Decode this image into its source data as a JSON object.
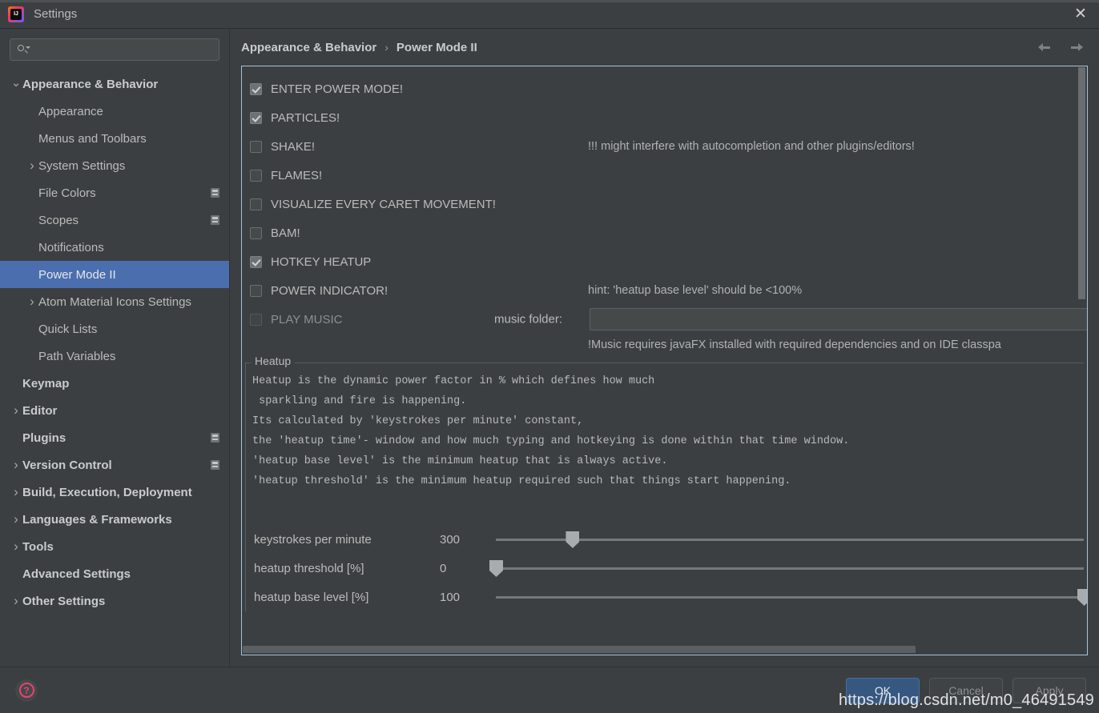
{
  "window": {
    "title": "Settings",
    "app_icon": "intellij-idea-logo",
    "close_label": "✕"
  },
  "sidebar": {
    "search": {
      "value": "",
      "placeholder": ""
    },
    "items": [
      {
        "label": "Appearance & Behavior",
        "indent": 0,
        "chevron": "down",
        "bold": true,
        "selected": false,
        "config_icon": false
      },
      {
        "label": "Appearance",
        "indent": 1,
        "chevron": "",
        "bold": false,
        "selected": false,
        "config_icon": false
      },
      {
        "label": "Menus and Toolbars",
        "indent": 1,
        "chevron": "",
        "bold": false,
        "selected": false,
        "config_icon": false
      },
      {
        "label": "System Settings",
        "indent": 1,
        "chevron": "right",
        "bold": false,
        "selected": false,
        "config_icon": false
      },
      {
        "label": "File Colors",
        "indent": 1,
        "chevron": "",
        "bold": false,
        "selected": false,
        "config_icon": true
      },
      {
        "label": "Scopes",
        "indent": 1,
        "chevron": "",
        "bold": false,
        "selected": false,
        "config_icon": true
      },
      {
        "label": "Notifications",
        "indent": 1,
        "chevron": "",
        "bold": false,
        "selected": false,
        "config_icon": false
      },
      {
        "label": "Power Mode II",
        "indent": 1,
        "chevron": "",
        "bold": false,
        "selected": true,
        "config_icon": false
      },
      {
        "label": "Atom Material Icons Settings",
        "indent": 1,
        "chevron": "right",
        "bold": false,
        "selected": false,
        "config_icon": false
      },
      {
        "label": "Quick Lists",
        "indent": 1,
        "chevron": "",
        "bold": false,
        "selected": false,
        "config_icon": false
      },
      {
        "label": "Path Variables",
        "indent": 1,
        "chevron": "",
        "bold": false,
        "selected": false,
        "config_icon": false
      },
      {
        "label": "Keymap",
        "indent": 0,
        "chevron": "",
        "bold": true,
        "selected": false,
        "config_icon": false
      },
      {
        "label": "Editor",
        "indent": 0,
        "chevron": "right",
        "bold": true,
        "selected": false,
        "config_icon": false
      },
      {
        "label": "Plugins",
        "indent": 0,
        "chevron": "",
        "bold": true,
        "selected": false,
        "config_icon": true
      },
      {
        "label": "Version Control",
        "indent": 0,
        "chevron": "right",
        "bold": true,
        "selected": false,
        "config_icon": true
      },
      {
        "label": "Build, Execution, Deployment",
        "indent": 0,
        "chevron": "right",
        "bold": true,
        "selected": false,
        "config_icon": false
      },
      {
        "label": "Languages & Frameworks",
        "indent": 0,
        "chevron": "right",
        "bold": true,
        "selected": false,
        "config_icon": false
      },
      {
        "label": "Tools",
        "indent": 0,
        "chevron": "right",
        "bold": true,
        "selected": false,
        "config_icon": false
      },
      {
        "label": "Advanced Settings",
        "indent": 0,
        "chevron": "",
        "bold": true,
        "selected": false,
        "config_icon": false
      },
      {
        "label": "Other Settings",
        "indent": 0,
        "chevron": "right",
        "bold": true,
        "selected": false,
        "config_icon": false
      }
    ]
  },
  "breadcrumb": {
    "parent": "Appearance & Behavior",
    "separator": "›",
    "current": "Power Mode II",
    "back_icon": "arrow-left-icon",
    "forward_icon": "arrow-right-icon"
  },
  "options": [
    {
      "label": "ENTER POWER MODE!",
      "checked": true,
      "enabled": true,
      "hint": ""
    },
    {
      "label": "PARTICLES!",
      "checked": true,
      "enabled": true,
      "hint": ""
    },
    {
      "label": "SHAKE!",
      "checked": false,
      "enabled": true,
      "hint": "!!! might interfere with autocompletion and other plugins/editors!"
    },
    {
      "label": "FLAMES!",
      "checked": false,
      "enabled": true,
      "hint": ""
    },
    {
      "label": "VISUALIZE EVERY CARET MOVEMENT!",
      "checked": false,
      "enabled": true,
      "hint": ""
    },
    {
      "label": "BAM!",
      "checked": false,
      "enabled": true,
      "hint": ""
    },
    {
      "label": "HOTKEY HEATUP",
      "checked": true,
      "enabled": true,
      "hint": ""
    },
    {
      "label": "POWER INDICATOR!",
      "checked": false,
      "enabled": true,
      "hint": "hint: 'heatup base level' should be <100%"
    }
  ],
  "music": {
    "checkbox_label": "PLAY MUSIC",
    "checked": false,
    "enabled": false,
    "folder_label": "music folder:",
    "folder_value": "",
    "note": "!Music requires javaFX installed with required dependencies and on IDE classpa"
  },
  "heatup": {
    "legend": "Heatup",
    "description_lines": [
      "Heatup is the dynamic power factor in % which defines how much",
      " sparkling and fire is happening.",
      "Its calculated by 'keystrokes per minute' constant,",
      "the 'heatup time'- window and how much typing and hotkeying is done within that time window.",
      "'heatup base level' is the minimum heatup that is always active.",
      "'heatup threshold' is the minimum heatup required such that things start happening."
    ],
    "sliders": [
      {
        "name": "keystrokes per minute",
        "value": "300",
        "percent": 13
      },
      {
        "name": "heatup threshold [%]",
        "value": "0",
        "percent": 0
      },
      {
        "name": "heatup base level [%]",
        "value": "100",
        "percent": 100
      }
    ]
  },
  "footer": {
    "help_icon": "question-mark-icon",
    "ok_label": "OK",
    "cancel_label": "Cancel",
    "apply_label": "Apply"
  },
  "overlay": {
    "watermark": "https://blog.csdn.net/m0_46491549"
  },
  "colors": {
    "background": "#3c3f41",
    "selection": "#4b6eaf",
    "panel_border": "#a6c2dc",
    "primary_button": "#365880",
    "help_accent": "#e8436f",
    "text": "#bbbbbb"
  }
}
